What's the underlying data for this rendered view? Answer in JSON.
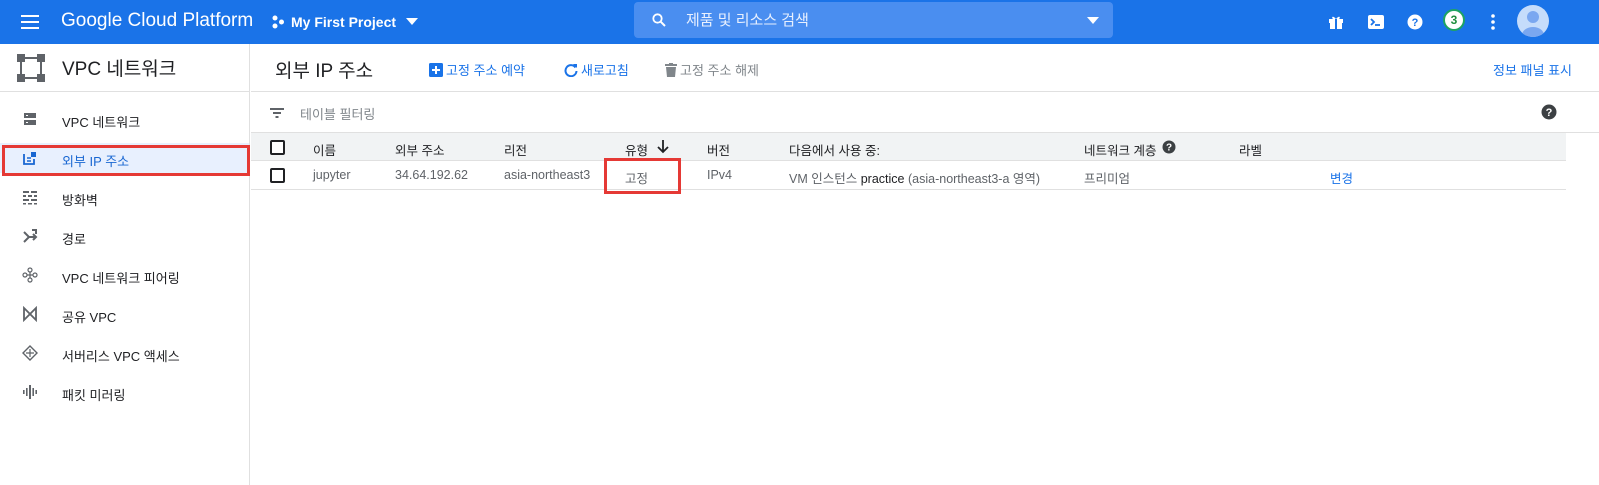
{
  "topbar": {
    "brand": "Google Cloud Platform",
    "project": "My First Project",
    "search_placeholder": "제품 및 리소스 검색",
    "notification_count": "3",
    "accent_color": "#1a73e8"
  },
  "sidebar": {
    "title": "VPC 네트워크",
    "items": [
      {
        "label": "VPC 네트워크",
        "icon": "vpc-network-icon",
        "active": false
      },
      {
        "label": "외부 IP 주소",
        "icon": "external-ip-icon",
        "active": true
      },
      {
        "label": "방화벽",
        "icon": "firewall-icon",
        "active": false
      },
      {
        "label": "경로",
        "icon": "routes-icon",
        "active": false
      },
      {
        "label": "VPC 네트워크 피어링",
        "icon": "peering-icon",
        "active": false
      },
      {
        "label": "공유 VPC",
        "icon": "shared-vpc-icon",
        "active": false
      },
      {
        "label": "서버리스 VPC 액세스",
        "icon": "serverless-vpc-icon",
        "active": false
      },
      {
        "label": "패킷 미러링",
        "icon": "packet-mirroring-icon",
        "active": false
      }
    ]
  },
  "header": {
    "title": "외부 IP 주소",
    "reserve_label": "고정 주소 예약",
    "refresh_label": "새로고침",
    "release_label": "고정 주소 해제",
    "info_panel_label": "정보 패널 표시"
  },
  "filter": {
    "placeholder": "테이블 필터링"
  },
  "table": {
    "columns": [
      "이름",
      "외부 주소",
      "리전",
      "유형",
      "버전",
      "다음에서 사용 중:",
      "네트워크 계층",
      "라벨"
    ],
    "sort_column": "유형",
    "sort_direction": "descending",
    "rows": [
      {
        "name": "jupyter",
        "address": "34.64.192.62",
        "region": "asia-northeast3",
        "type": "고정",
        "version": "IPv4",
        "in_use_prefix": "VM 인스턴스",
        "in_use_name": "practice",
        "in_use_suffix": "(asia-northeast3-a 영역)",
        "tier": "프리미엄",
        "labels": "",
        "action": "변경"
      }
    ]
  }
}
